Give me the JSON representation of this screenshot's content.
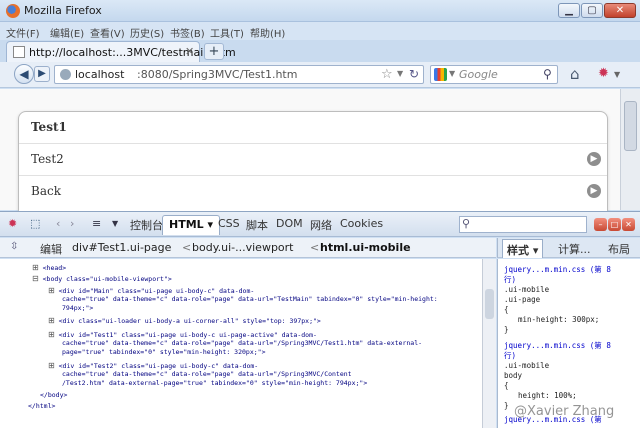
{
  "window": {
    "title": "Mozilla Firefox"
  },
  "menu": [
    "文件(F)",
    "编辑(E)",
    "查看(V)",
    "历史(S)",
    "书签(B)",
    "工具(T)",
    "帮助(H)"
  ],
  "tab": {
    "label": "http://localhost:...3MVC/testmain.htm",
    "new_tab": "+"
  },
  "urlbar": {
    "host": "localhost",
    "path": ":8080/Spring3MVC/Test1.htm"
  },
  "search": {
    "placeholder": "Google"
  },
  "listview": {
    "items": [
      "Test1",
      "Test2",
      "Back"
    ]
  },
  "firebug": {
    "tools": {
      "console": "控制台",
      "html": "HTML",
      "css": "CSS",
      "script": "脚本",
      "dom": "DOM",
      "net": "网络",
      "cookies": "Cookies"
    },
    "edit": "编辑",
    "breadcrumb": {
      "a": "div#Test1.ui-page",
      "b": "body.ui-...viewport",
      "c": "html.ui-mobile"
    },
    "side_tabs": {
      "style": "样式",
      "computed": "计算...",
      "layout": "布局"
    },
    "html_lines": [
      "<head>",
      "<body class=\"ui-mobile-viewport\">",
      "<div id=\"Main\" class=\"ui-page ui-body-c\" data-dom-",
      "cache=\"true\" data-theme=\"c\" data-role=\"page\" data-url=\"TestMain\" tabindex=\"0\" style=\"min-height:",
      "794px;\">",
      "<div class=\"ui-loader ui-body-a ui-corner-all\" style=\"top: 397px;\">",
      "<div id=\"Test1\" class=\"ui-page ui-body-c ui-page-active\" data-dom-",
      "cache=\"true\" data-theme=\"c\" data-role=\"page\" data-url=\"/Spring3MVC/Test1.htm\" data-external-",
      "page=\"true\" tabindex=\"0\" style=\"min-height: 320px;\">",
      "<div id=\"Test2\" class=\"ui-page ui-body-c\" data-dom-",
      "cache=\"true\" data-theme=\"c\" data-role=\"page\" data-url=\"/Spring3MVC/Content",
      "/Test2.htm\" data-external-page=\"true\" tabindex=\"0\" style=\"min-height: 794px;\">",
      "</body>",
      "</html>"
    ],
    "css_lines": [
      "jquery...m.min.css (第 8",
      "行)",
      ".ui-mobile",
      ".ui-page",
      "{",
      "min-height: 300px;",
      "}",
      "jquery...m.min.css (第 8",
      "行)",
      ".ui-mobile",
      "body",
      "{",
      "height: 100%;",
      "}",
      "jquery...m.min.css (第"
    ]
  },
  "watermark": "@Xavier Zhang"
}
